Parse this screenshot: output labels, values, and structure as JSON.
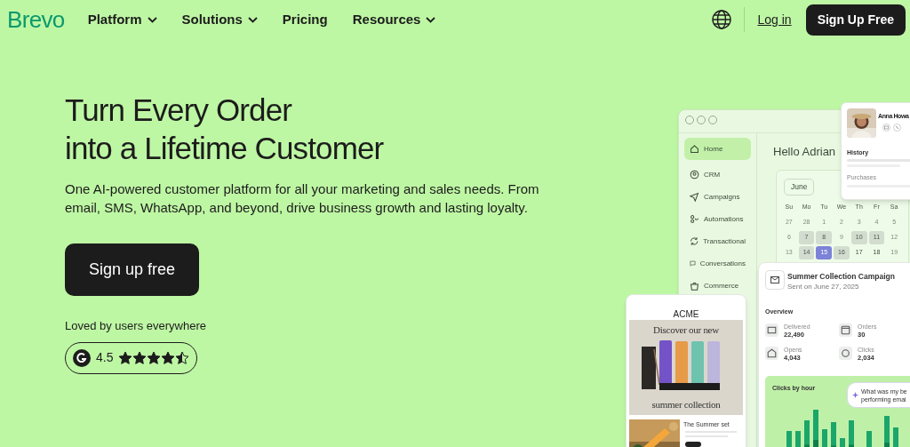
{
  "nav": {
    "logo": "Brevo",
    "items": [
      {
        "label": "Platform",
        "has_menu": true
      },
      {
        "label": "Solutions",
        "has_menu": true
      },
      {
        "label": "Pricing",
        "has_menu": false
      },
      {
        "label": "Resources",
        "has_menu": true
      }
    ],
    "login": "Log in",
    "signup": "Sign Up Free"
  },
  "hero": {
    "title_lines": [
      "Turn Every Order",
      "into a Lifetime Customer"
    ],
    "body": "One AI-powered customer platform for all your marketing and sales needs. From email, SMS, WhatsApp, and beyond, drive business growth and lasting loyalty.",
    "cta": "Sign up free",
    "loved": "Loved by users everywhere",
    "rating": {
      "value": "4.5",
      "stars": 4.5
    }
  },
  "app": {
    "sidebar": [
      {
        "label": "Home",
        "selected": true
      },
      {
        "label": "CRM",
        "selected": false
      },
      {
        "label": "Campaigns",
        "selected": false
      },
      {
        "label": "Automations",
        "selected": false
      },
      {
        "label": "Transactional",
        "selected": false
      },
      {
        "label": "Conversations",
        "selected": false
      },
      {
        "label": "Commerce",
        "selected": false
      }
    ],
    "greeting": "Hello Adrian",
    "calendar": {
      "month": "June",
      "weekdays": [
        "Su",
        "Mo",
        "Tu",
        "We",
        "Th",
        "Fr",
        "Sa"
      ],
      "days": [
        {
          "label": "27",
          "kind": "faint"
        },
        {
          "label": "28",
          "kind": "faint"
        },
        {
          "label": "1",
          "kind": "faint"
        },
        {
          "label": "2",
          "kind": "faint"
        },
        {
          "label": "3",
          "kind": "faint"
        },
        {
          "label": "4",
          "kind": "faint"
        },
        {
          "label": "5",
          "kind": "faint"
        },
        {
          "label": "6",
          "kind": "faint"
        },
        {
          "label": "7",
          "kind": "marked"
        },
        {
          "label": "8",
          "kind": "marked"
        },
        {
          "label": "9",
          "kind": "faint"
        },
        {
          "label": "10",
          "kind": "marked"
        },
        {
          "label": "11",
          "kind": "marked"
        },
        {
          "label": "12",
          "kind": "faint"
        },
        {
          "label": "13",
          "kind": "faint"
        },
        {
          "label": "14",
          "kind": "marked"
        },
        {
          "label": "15",
          "kind": "today"
        },
        {
          "label": "16",
          "kind": "marked"
        },
        {
          "label": "17",
          "kind": "plain"
        },
        {
          "label": "18",
          "kind": "plain"
        },
        {
          "label": "19",
          "kind": "faint"
        }
      ]
    },
    "profile": {
      "name": "Anna Howa",
      "history": "History",
      "purchases": "Purchases"
    },
    "campaign": {
      "title": "Summer Collection Campaign",
      "sent": "Sent on June 27, 2025",
      "overview": "Overview",
      "stats": [
        {
          "label": "Delivered",
          "value": "22,490"
        },
        {
          "label": "Orders",
          "value": "30"
        },
        {
          "label": "Opens",
          "value": "4,043"
        },
        {
          "label": "Clicks",
          "value": "2,034"
        }
      ],
      "chart_title": "Clicks by hour",
      "assistant_lines": [
        "What was my be",
        "performing emai"
      ]
    },
    "email": {
      "brand": "ACME",
      "headline": "Discover our new",
      "footer": "summer collection",
      "product": "The Summer set"
    }
  }
}
